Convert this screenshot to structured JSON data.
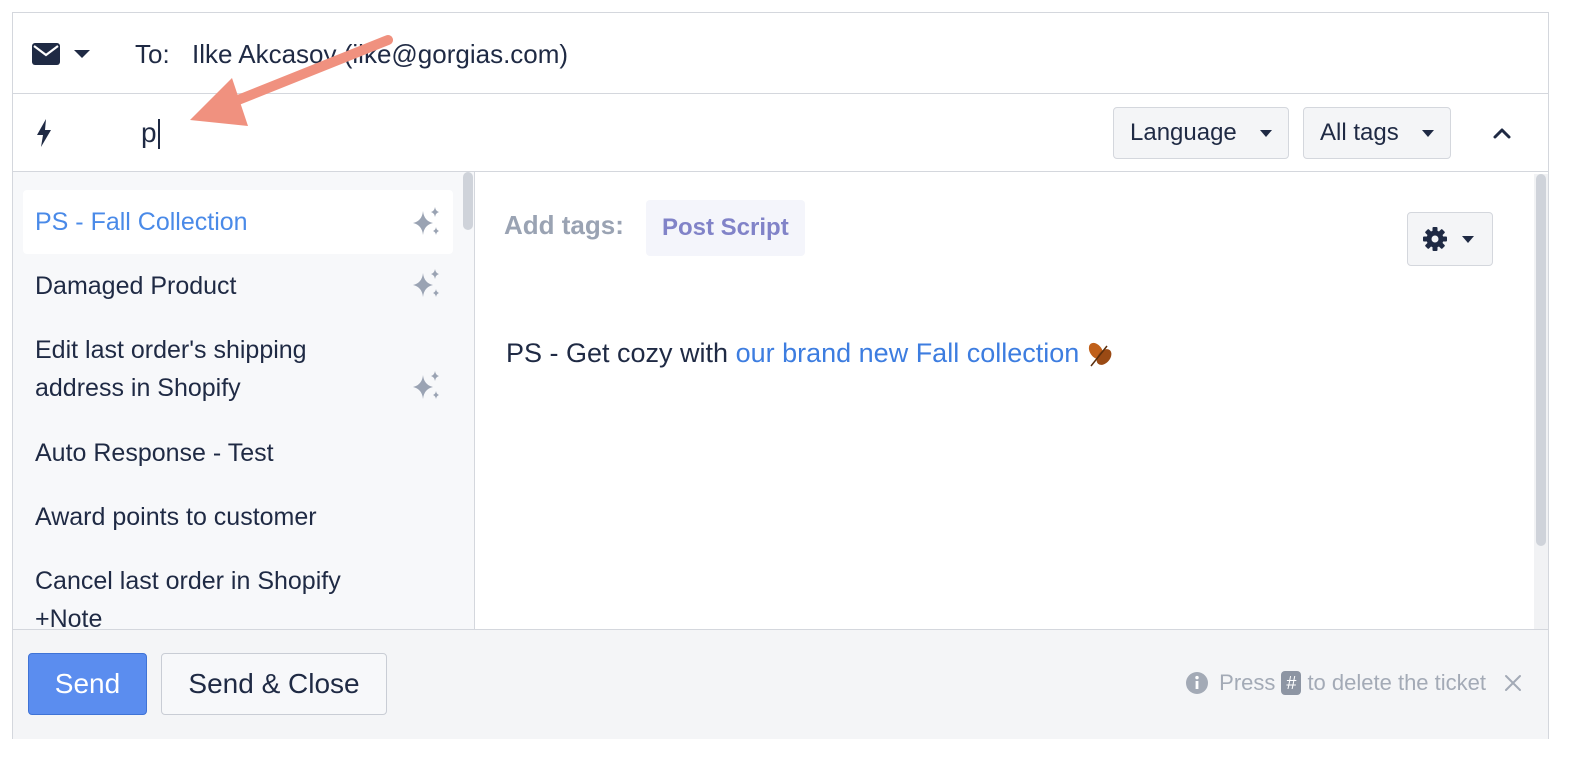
{
  "header": {
    "to_label": "To:",
    "to_value": "Ilke Akcasoy (ilke@gorgias.com)"
  },
  "search": {
    "value": "p",
    "language_label": "Language",
    "tags_label": "All tags"
  },
  "macros": {
    "items": [
      {
        "label": "PS - Fall Collection",
        "ai": true,
        "active": true
      },
      {
        "label": "Damaged Product",
        "ai": true,
        "active": false
      },
      {
        "label": "Edit last order's shipping address in Shopify",
        "ai": true,
        "active": false
      },
      {
        "label": "Auto Response - Test",
        "ai": false,
        "active": false
      },
      {
        "label": "Award points to customer",
        "ai": false,
        "active": false
      },
      {
        "label": "Cancel last order in Shopify +Note",
        "ai": false,
        "active": false
      }
    ]
  },
  "preview": {
    "add_tags_label": "Add tags:",
    "tag": "Post Script",
    "body_prefix": "PS - Get cozy with ",
    "body_link": "our brand new Fall collection"
  },
  "footer": {
    "send_label": "Send",
    "send_close_label": "Send & Close",
    "hint_prefix": "Press",
    "hint_key": "#",
    "hint_suffix": "to delete the ticket"
  },
  "colors": {
    "accent": "#5b8def",
    "link": "#3d7de0",
    "tag_text": "#8183c8",
    "annotation_arrow": "#f0917f"
  },
  "icons": [
    "envelope-icon",
    "chevron-down-icon",
    "bolt-icon",
    "chevron-up-icon",
    "sparkle-icon",
    "gear-icon",
    "leaf-icon",
    "info-icon",
    "close-icon"
  ]
}
